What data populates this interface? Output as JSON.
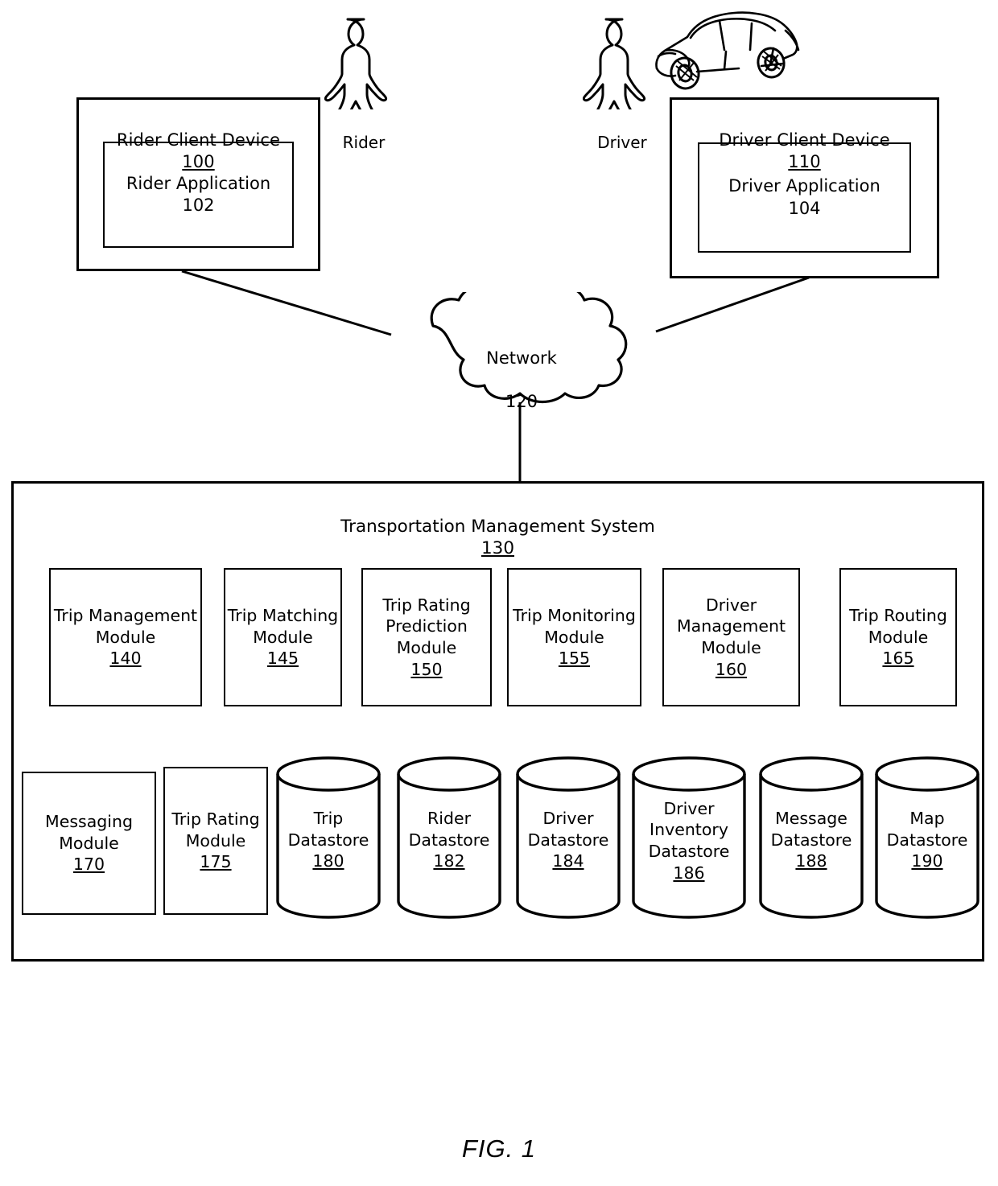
{
  "figure": {
    "caption": "FIG. 1"
  },
  "actors": [
    {
      "id": "rider",
      "label": "Rider",
      "icon": "person-icon"
    },
    {
      "id": "driver",
      "label": "Driver",
      "icon": "person-icon"
    }
  ],
  "vehicle": {
    "icon": "car-icon"
  },
  "client_devices": [
    {
      "id": "rider-client-device",
      "title": "Rider Client Device",
      "ref": "100",
      "app": {
        "name": "Rider\nApplication",
        "ref": "102"
      }
    },
    {
      "id": "driver-client-device",
      "title": "Driver Client Device",
      "ref": "110",
      "app": {
        "name": "Driver Application",
        "ref": "104"
      }
    }
  ],
  "network": {
    "label": "Network",
    "ref": "120",
    "icon": "cloud-icon"
  },
  "system": {
    "title": "Transportation Management System",
    "ref": "130",
    "modules_row1": [
      {
        "name": "Trip\nManagement\nModule",
        "ref": "140"
      },
      {
        "name": "Trip\nMatching\nModule",
        "ref": "145"
      },
      {
        "name": "Trip Rating\nPrediction\nModule",
        "ref": "150"
      },
      {
        "name": "Trip\nMonitoring\nModule",
        "ref": "155"
      },
      {
        "name": "Driver\nManagement\nModule",
        "ref": "160"
      },
      {
        "name": "Trip\nRouting\nModule",
        "ref": "165"
      }
    ],
    "modules_row2": [
      {
        "name": "Messaging\nModule",
        "ref": "170"
      },
      {
        "name": "Trip\nRating\nModule",
        "ref": "175"
      }
    ],
    "datastores": [
      {
        "name": "Trip\nDatastore",
        "ref": "180"
      },
      {
        "name": "Rider\nDatastore",
        "ref": "182"
      },
      {
        "name": "Driver\nDatastore",
        "ref": "184"
      },
      {
        "name": "Driver\nInventory\nDatastore",
        "ref": "186"
      },
      {
        "name": "Message\nDatastore",
        "ref": "188"
      },
      {
        "name": "Map\nDatastore",
        "ref": "190"
      }
    ]
  },
  "colors": {
    "stroke": "#000000",
    "background": "#ffffff"
  }
}
